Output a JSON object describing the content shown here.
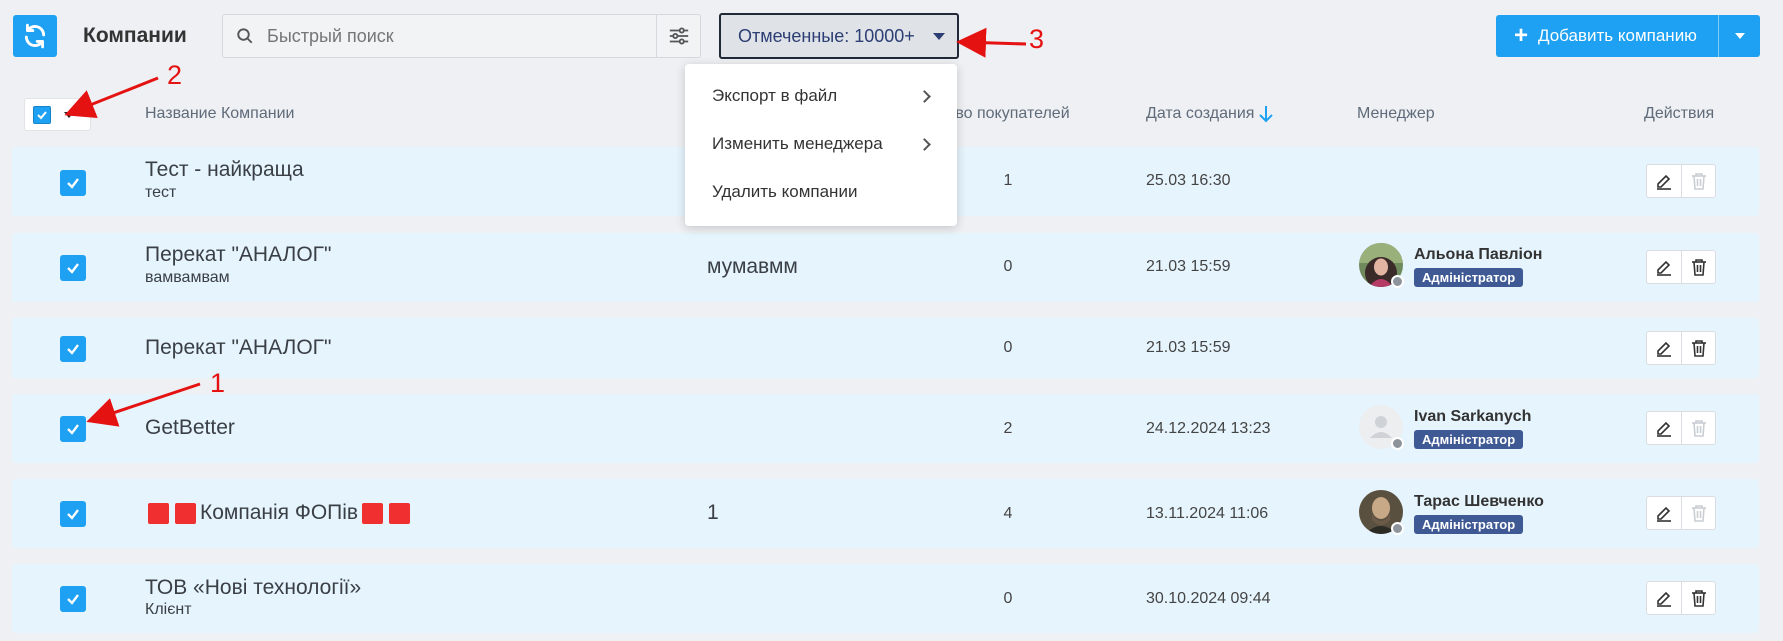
{
  "header": {
    "title": "Компании",
    "search_placeholder": "Быстрый поиск",
    "marked_label": "Отмеченные: 10000+",
    "add_label": "Добавить компанию"
  },
  "dropdown": {
    "items": [
      {
        "label": "Экспорт в файл",
        "has_submenu": true
      },
      {
        "label": "Изменить менеджера",
        "has_submenu": true
      },
      {
        "label": "Удалить компании",
        "has_submenu": false
      }
    ]
  },
  "columns": {
    "name": "Название Компании",
    "buyers": "ство покупателей",
    "created": "Дата создания",
    "manager": "Менеджер",
    "actions": "Действия"
  },
  "rows": [
    {
      "name": "Тест - найкраща",
      "sub": "тест",
      "col2": "",
      "count": "1",
      "date": "25.03 16:30",
      "manager": null,
      "delete_enabled": false
    },
    {
      "name": "Перекат \"АНАЛОГ\"",
      "sub": "вамвамвам",
      "col2": "мумавмм",
      "count": "0",
      "date": "21.03 15:59",
      "manager": {
        "name": "Альона Павліон",
        "role": "Адміністратор",
        "avatar": "photo-woman"
      },
      "delete_enabled": true
    },
    {
      "name": "Перекат \"АНАЛОГ\"",
      "sub": "",
      "col2": "",
      "count": "0",
      "date": "21.03 15:59",
      "manager": null,
      "delete_enabled": true
    },
    {
      "name": "GetBetter",
      "sub": "",
      "col2": "",
      "count": "2",
      "date": "24.12.2024 13:23",
      "manager": {
        "name": "Ivan Sarkanych",
        "role": "Адміністратор",
        "avatar": "placeholder-user"
      },
      "delete_enabled": false
    },
    {
      "name": "Компанія ФОПів",
      "sub": "",
      "col2": "1",
      "count": "4",
      "date": "13.11.2024 11:06",
      "manager": {
        "name": "Тарас Шевченко",
        "role": "Адміністратор",
        "avatar": "photo-man"
      },
      "delete_enabled": false
    },
    {
      "name": "ТОВ «Нові технології»",
      "sub": "Клієнт",
      "col2": "",
      "count": "0",
      "date": "30.10.2024 09:44",
      "manager": null,
      "delete_enabled": true
    }
  ],
  "annotations": {
    "a1": "1",
    "a2": "2",
    "a3": "3"
  },
  "colors": {
    "accent": "#1ea1f2",
    "row_bg": "#e6f4fd",
    "role_badge": "#3f5994",
    "annotation": "#e51212",
    "emoji_square": "#f03030"
  },
  "icons": [
    "refresh-icon",
    "search-icon",
    "sliders-icon",
    "caret-down-icon",
    "plus-icon",
    "check-icon",
    "sort-arrow-down-icon",
    "edit-icon",
    "trash-icon",
    "chevron-right-icon"
  ]
}
